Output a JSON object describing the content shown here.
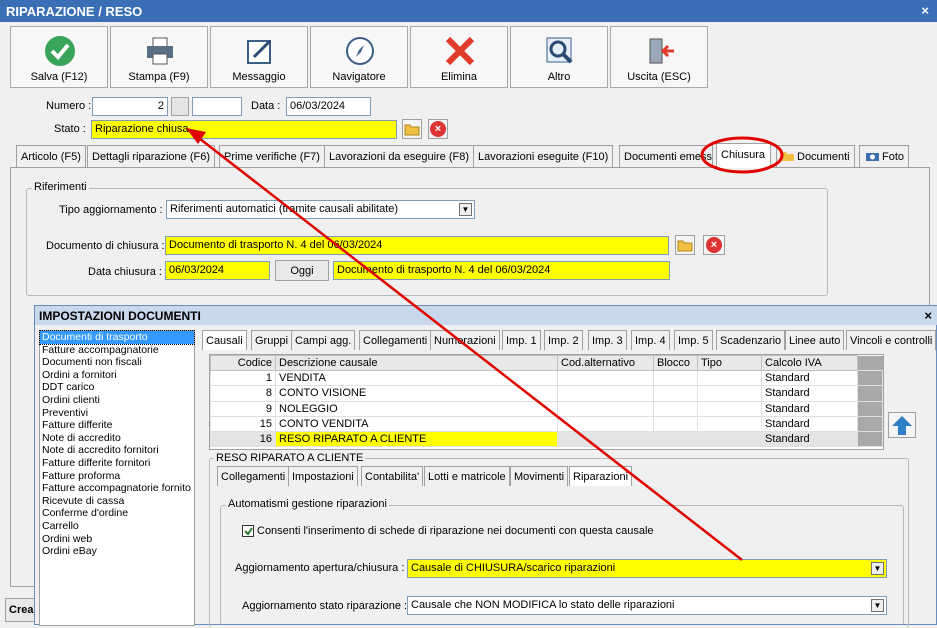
{
  "window": {
    "title": "RIPARAZIONE / RESO",
    "close": "×"
  },
  "toolbar": [
    {
      "label": "Salva (F12)",
      "icon": "check-icon"
    },
    {
      "label": "Stampa (F9)",
      "icon": "printer-icon"
    },
    {
      "label": "Messaggio",
      "icon": "message-icon"
    },
    {
      "label": "Navigatore",
      "icon": "compass-icon"
    },
    {
      "label": "Elimina",
      "icon": "delete-icon"
    },
    {
      "label": "Altro",
      "icon": "search-icon"
    },
    {
      "label": "Uscita (ESC)",
      "icon": "exit-icon"
    }
  ],
  "header": {
    "numero_label": "Numero :",
    "numero": "2",
    "data_label": "Data :",
    "data": "06/03/2024",
    "stato_label": "Stato :",
    "stato": "Riparazione chiusa"
  },
  "tabs": [
    "Articolo (F5)",
    "Dettagli riparazione (F6)",
    "Prime verifiche (F7)",
    "Lavorazioni da eseguire (F8)",
    "Lavorazioni eseguite  (F10)",
    "Documenti emess",
    "Chiusura",
    "Documenti",
    "Foto"
  ],
  "riferimenti": {
    "legend": "Riferimenti",
    "tipo_label": "Tipo aggiornamento :",
    "tipo_value": "Riferimenti automatici (tramite causali abilitate)",
    "doc_label": "Documento di chiusura :",
    "doc_value": "Documento di trasporto N. 4 del 06/03/2024",
    "data_label": "Data chiusura :",
    "data_value": "06/03/2024",
    "oggi": "Oggi",
    "data_doc_value": "Documento di trasporto N. 4 del 06/03/2024"
  },
  "bottom_left": "Crea",
  "dialog": {
    "title": "IMPOSTAZIONI DOCUMENTI",
    "close": "×",
    "list": [
      "Documenti di trasporto",
      "Fatture accompagnatorie",
      "Documenti non fiscali",
      "Ordini a fornitori",
      "DDT carico",
      "Ordini clienti",
      "Preventivi",
      "Fatture differite",
      "Note di accredito",
      "Note di accredito fornitori",
      "Fatture differite fornitori",
      "Fatture proforma",
      "Fatture accompagnatorie fornito",
      "Ricevute di cassa",
      "Conferme d'ordine",
      "Carrello",
      "Ordini web",
      "Ordini eBay"
    ],
    "tabs": [
      "Causali",
      "Gruppi",
      "Campi agg.",
      "Collegamenti",
      "Numerazioni",
      "Imp. 1",
      "Imp. 2",
      "Imp. 3",
      "Imp. 4",
      "Imp. 5",
      "Scadenzario",
      "Linee auto",
      "Vincoli e controlli"
    ],
    "grid": {
      "columns": [
        "Codice",
        "Descrizione causale",
        "Cod.alternativo",
        "Blocco",
        "Tipo",
        "Calcolo IVA"
      ],
      "rows": [
        [
          "1",
          "VENDITA",
          "",
          "",
          "",
          "Standard"
        ],
        [
          "8",
          "CONTO VISIONE",
          "",
          "",
          "",
          "Standard"
        ],
        [
          "9",
          "NOLEGGIO",
          "",
          "",
          "",
          "Standard"
        ],
        [
          "15",
          "CONTO VENDITA",
          "",
          "",
          "",
          "Standard"
        ],
        [
          "16",
          "RESO RIPARATO A CLIENTE",
          "",
          "",
          "",
          "Standard"
        ]
      ]
    },
    "causale_legend": "RESO RIPARATO A CLIENTE",
    "subtabs": [
      "Collegamenti",
      "Impostazioni",
      "Contabilita'",
      "Lotti e matricole",
      "Movimenti",
      "Riparazioni"
    ],
    "auto_legend": "Automatismi gestione riparazioni",
    "checkbox_label": "Consenti l'inserimento di schede di riparazione nei documenti con questa causale",
    "apertura_label": "Aggiornamento apertura/chiusura :",
    "apertura_value": "Causale di CHIUSURA/scarico riparazioni",
    "stato_label": "Aggiornamento stato riparazione :",
    "stato_value": "Causale che NON MODIFICA lo stato delle riparazioni"
  },
  "colors": {
    "highlight": "#ffff00",
    "annotation": "#e00000",
    "titlebar": "#3a6fb5"
  }
}
